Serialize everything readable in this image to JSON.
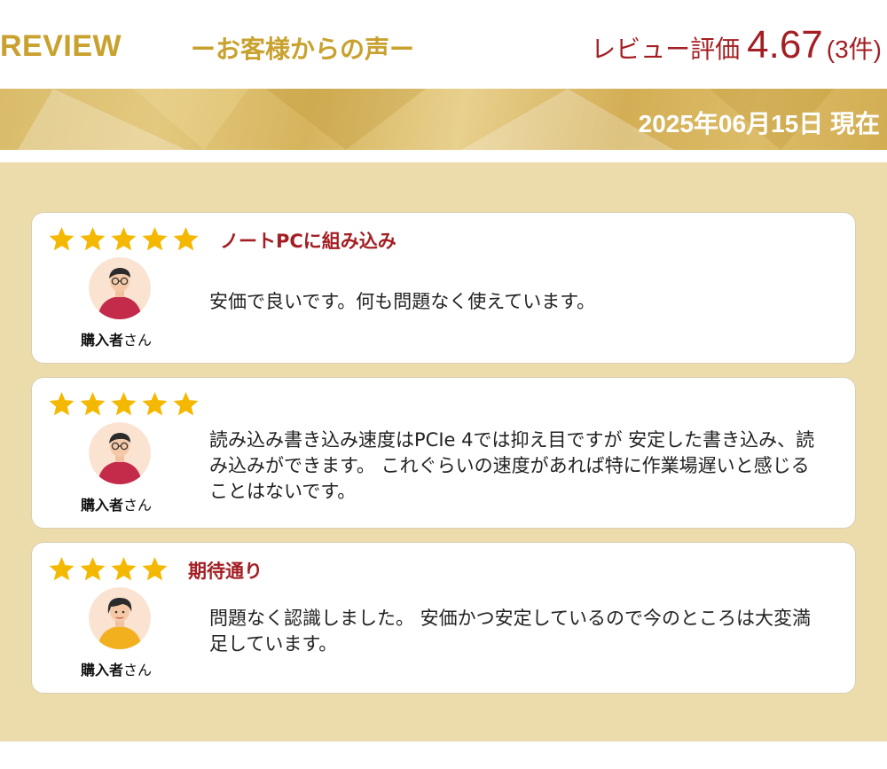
{
  "header": {
    "review_label": "REVIEW",
    "voice_label": "ーお客様からの声ー",
    "rating_label": "レビュー評価",
    "rating_score": "4.67",
    "rating_count": "(3件)"
  },
  "banner": {
    "date_text": "2025年06月15日 現在"
  },
  "colors": {
    "gold": "#c8a12e",
    "red": "#a31f24",
    "panel": "#ecdcab",
    "star": "#f5b800"
  },
  "reviews": [
    {
      "stars": 5,
      "title": "ノートPCに組み込み",
      "buyer_bold": "購入者",
      "buyer_suffix": "さん",
      "comment": "安価で良いです。何も問題なく使えています。",
      "avatar_icon": "person-red-glasses-avatar-icon"
    },
    {
      "stars": 5,
      "title": "",
      "buyer_bold": "購入者",
      "buyer_suffix": "さん",
      "comment": "読み込み書き込み速度はPCIe 4では抑え目ですが 安定した書き込み、読み込みができます。 これぐらいの速度があれば特に作業場遅いと感じることはないです。",
      "avatar_icon": "person-red-glasses-avatar-icon"
    },
    {
      "stars": 4,
      "title": "期待通り",
      "buyer_bold": "購入者",
      "buyer_suffix": "さん",
      "comment": "問題なく認識しました。 安価かつ安定しているので今のところは大変満足しています。",
      "avatar_icon": "person-yellow-avatar-icon"
    }
  ]
}
